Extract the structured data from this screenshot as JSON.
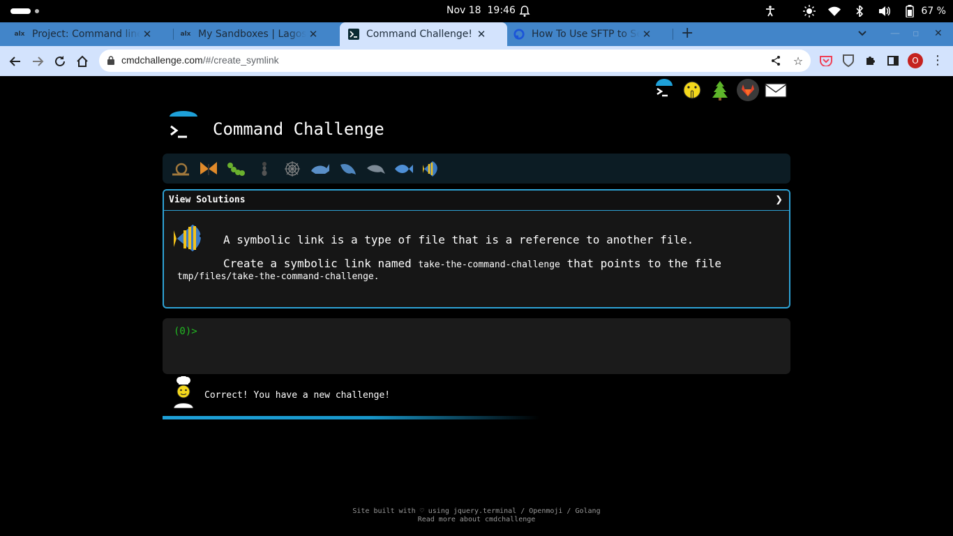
{
  "system_bar": {
    "date": "Nov 18",
    "time": "19:46",
    "battery": "67 %"
  },
  "tabs": [
    {
      "title": "Project: Command line fo",
      "favicon": "alx",
      "active": false
    },
    {
      "title": "My Sandboxes | Lagos Int",
      "favicon": "alx",
      "active": false
    },
    {
      "title": "Command Challenge!",
      "favicon": "terminal-icon",
      "active": true
    },
    {
      "title": "How To Use SFTP to Secu",
      "favicon": "digitalocean-icon",
      "active": false
    }
  ],
  "address_bar": {
    "host": "cmdchallenge.com",
    "path": "/#/create_symlink"
  },
  "profile_initial": "O",
  "page": {
    "title": "Command Challenge",
    "view_solutions": "View Solutions",
    "description": "A symbolic link is a type of file that is a reference to another file.",
    "task_prefix": "Create a symbolic link named ",
    "task_link_name": "take-the-command-challenge",
    "task_middle": " that points to the file",
    "task_target": "tmp/files/take-the-command-challenge.",
    "prompt": "(0)>",
    "result_message": "Correct! You have a new challenge!",
    "progress": 0.6,
    "footer_line1": "Site built with ♡ using jquery.terminal / Openmoji / Golang",
    "footer_line2": "Read more about cmdchallenge"
  },
  "colors": {
    "accent": "#2ea3d6",
    "prompt": "#22bb22",
    "tabstrip": "#4285c9",
    "toolbar": "#d3e3fd"
  }
}
